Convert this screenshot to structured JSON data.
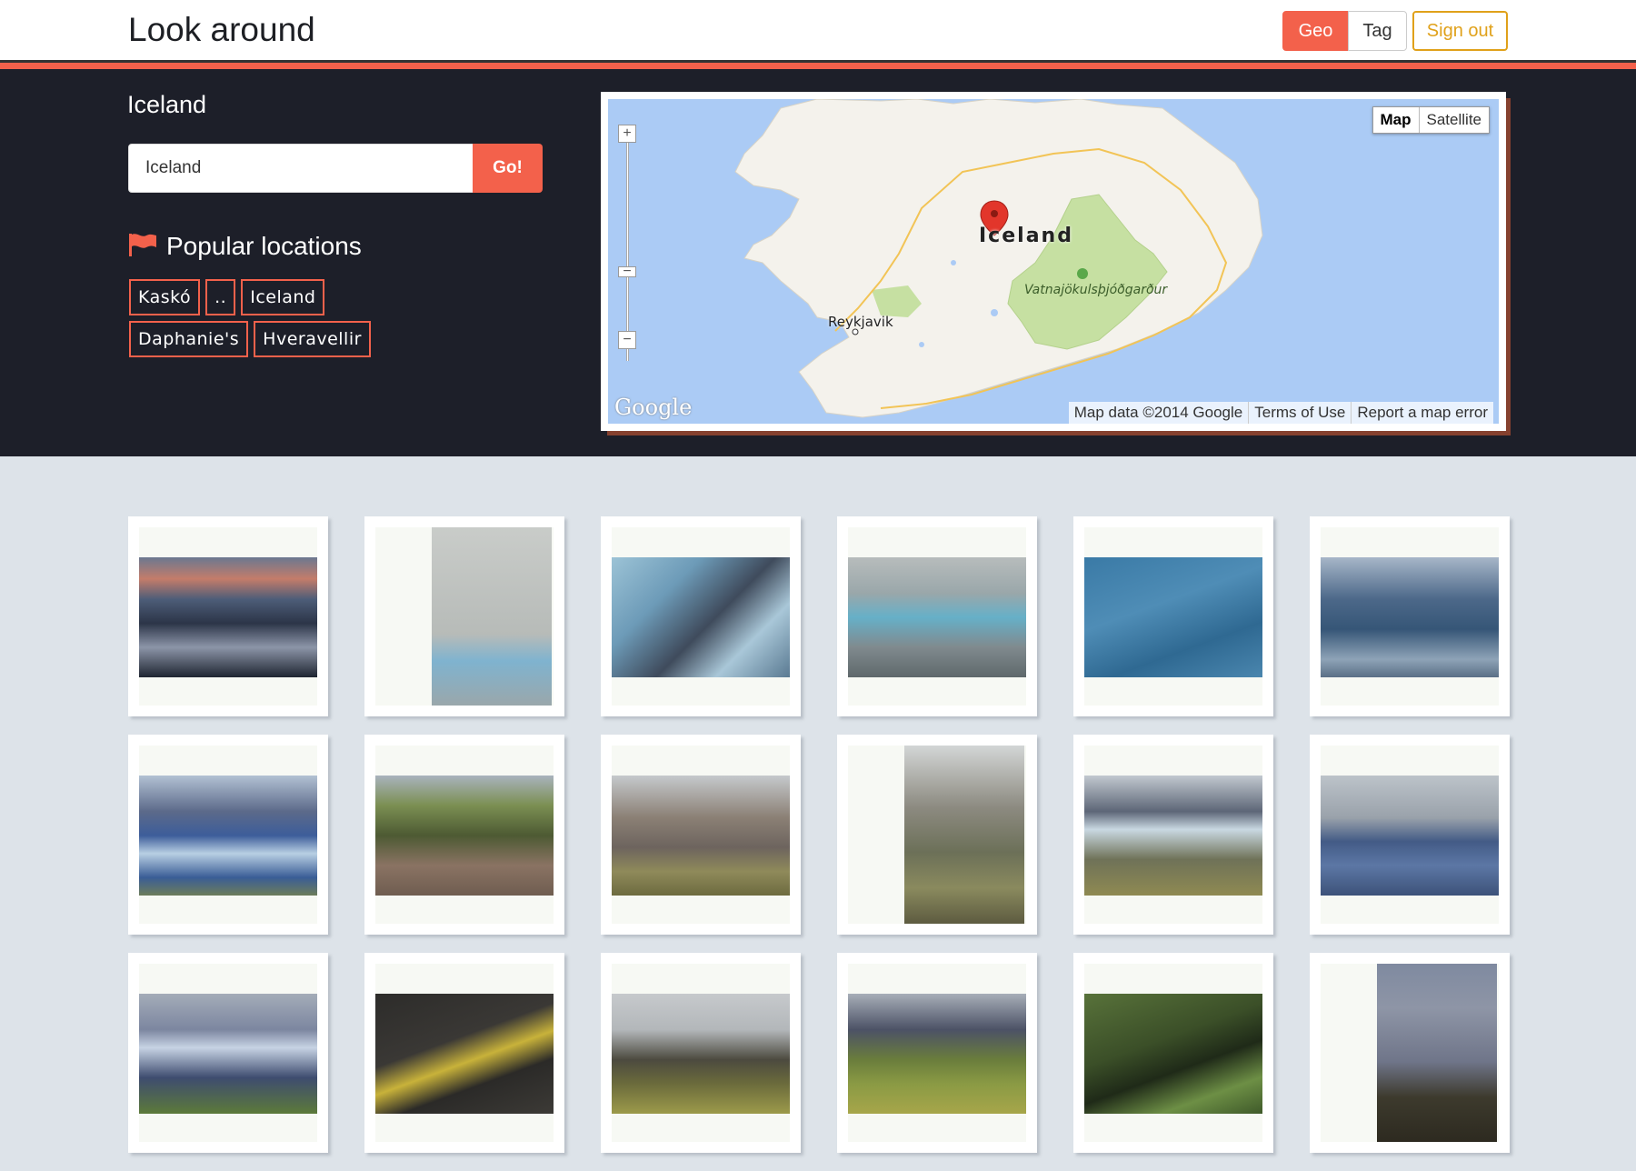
{
  "header": {
    "brand": "Look around",
    "nav": {
      "geo": "Geo",
      "tag": "Tag",
      "sign_out": "Sign out"
    },
    "accent_color": "#f3614b"
  },
  "hero": {
    "location_title": "Iceland",
    "search": {
      "value": "Iceland",
      "placeholder": "",
      "button": "Go!"
    },
    "popular": {
      "heading": "Popular locations",
      "icon": "flag-icon",
      "tags": [
        "Kaskó",
        "..",
        "Iceland",
        "Daphanie's",
        "Hveravellir"
      ]
    }
  },
  "map": {
    "type_buttons": [
      "Map",
      "Satellite"
    ],
    "selected_type": "Map",
    "country_label": "Iceland",
    "places": [
      "Reykjavik",
      "Vatnajökulsþjóðgarður"
    ],
    "logo": "Google",
    "footer": [
      "Map data ©2014 Google",
      "Terms of Use",
      "Report a map error"
    ]
  },
  "gallery": {
    "photos": [
      {
        "orientation": "landscape",
        "scene": "lagoon-sunset"
      },
      {
        "orientation": "portrait",
        "scene": "foggy-ice"
      },
      {
        "orientation": "landscape",
        "scene": "ice-blocks"
      },
      {
        "orientation": "landscape",
        "scene": "ice-lagoon"
      },
      {
        "orientation": "landscape",
        "scene": "aerial-water"
      },
      {
        "orientation": "landscape",
        "scene": "lagoon-ice"
      },
      {
        "orientation": "landscape",
        "scene": "glacier-valley"
      },
      {
        "orientation": "landscape",
        "scene": "green-mountain"
      },
      {
        "orientation": "landscape",
        "scene": "rocky-peaks"
      },
      {
        "orientation": "portrait",
        "scene": "person-bench"
      },
      {
        "orientation": "landscape",
        "scene": "glacier-pass"
      },
      {
        "orientation": "landscape",
        "scene": "glacier-closeup"
      },
      {
        "orientation": "landscape",
        "scene": "glacier-slope"
      },
      {
        "orientation": "landscape",
        "scene": "yellow-moss"
      },
      {
        "orientation": "landscape",
        "scene": "flat-mountain"
      },
      {
        "orientation": "landscape",
        "scene": "green-valley"
      },
      {
        "orientation": "landscape",
        "scene": "moss-plant"
      },
      {
        "orientation": "portrait",
        "scene": "red-moon"
      }
    ]
  }
}
